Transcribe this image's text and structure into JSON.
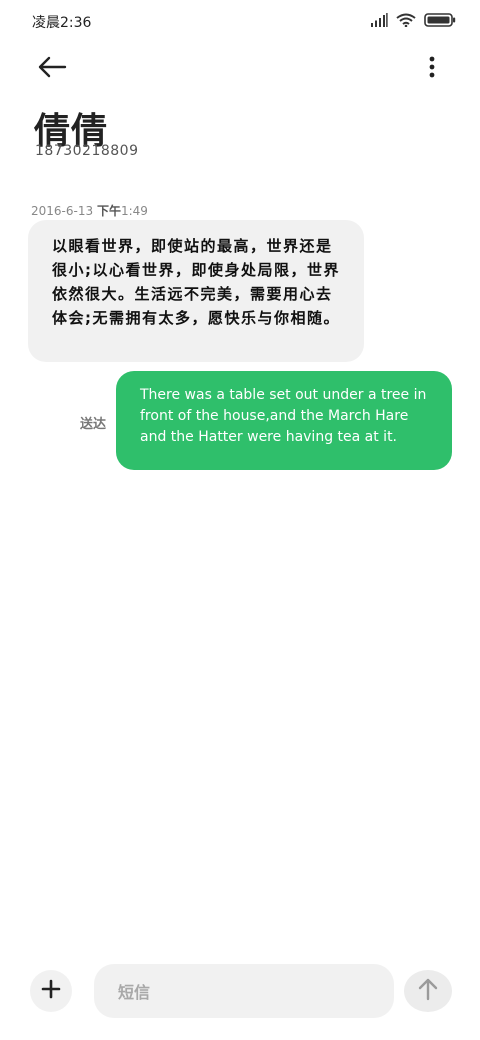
{
  "status_bar": {
    "time": "凌晨2:36",
    "icons": [
      "signal-icon",
      "wifi-icon",
      "battery-icon"
    ]
  },
  "header": {
    "back_icon": "arrow-left-icon",
    "more_icon": "more-vertical-icon"
  },
  "contact": {
    "name": "倩倩",
    "number": "18730218809"
  },
  "conversation": {
    "timestamp_date": "2016-6-13",
    "timestamp_ampm": "下午",
    "timestamp_time": "1:49",
    "received_message": "以眼看世界，即使站的最高，世界还是很小;以心看世界，即使身处局限，世界依然很大。生活远不完美，需要用心去体会;无需拥有太多，愿快乐与你相随。",
    "sent_status": "送达",
    "sent_message": "There was a table set out under a tree in front of the house,and the March Hare and the Hatter were having tea at it."
  },
  "composer": {
    "add_icon": "plus-icon",
    "placeholder": "短信",
    "send_icon": "arrow-up-icon"
  },
  "colors": {
    "sent_bubble": "#2fbf6b",
    "received_bubble": "#f1f1f1",
    "background": "#ffffff"
  }
}
